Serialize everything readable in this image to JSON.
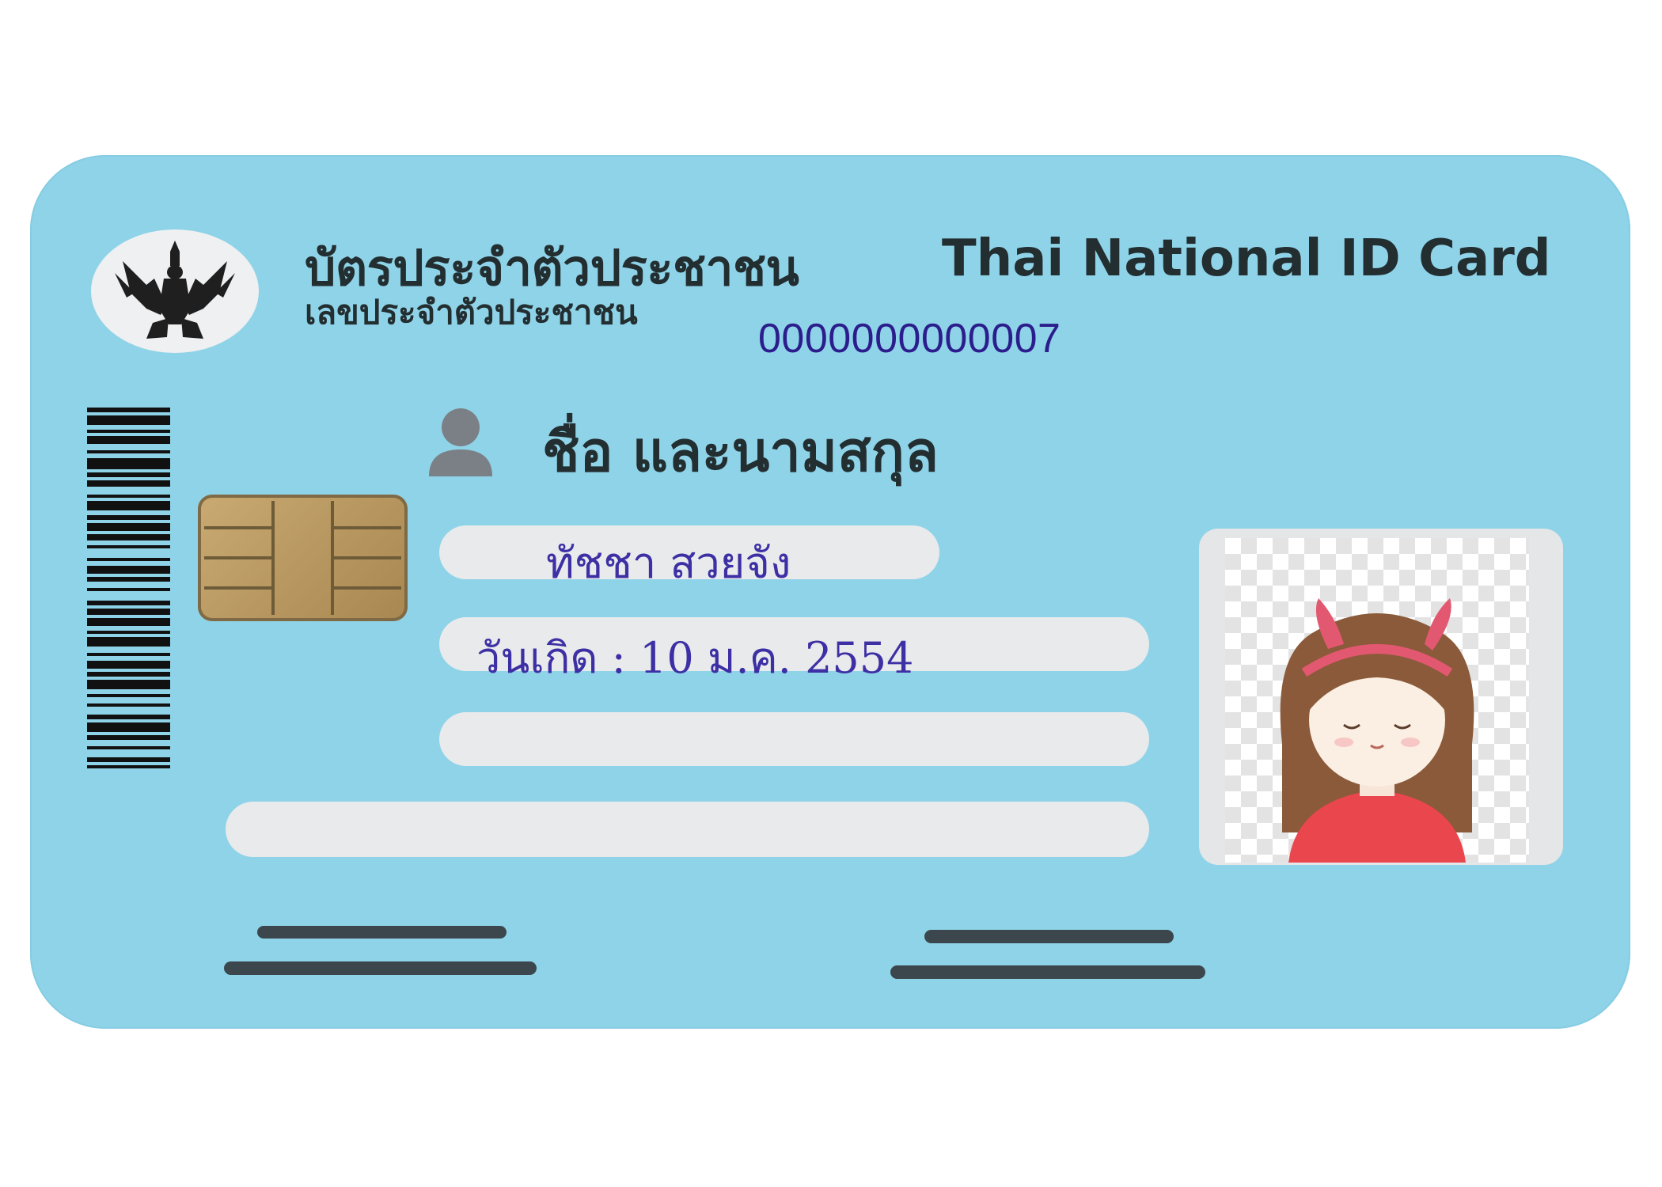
{
  "card": {
    "title_thai": "บัตรประจำตัวประชาชน",
    "title_english": "Thai National ID Card",
    "id_label": "เลขประจำตัวประชาชน",
    "id_number": "0000000000007",
    "name_label": "ชื่อ และนามสกุล",
    "holder_name": "ทัชชา  สวยจัง",
    "birth_date": "วันเกิด : 10 ม.ค. 2554"
  },
  "icons": {
    "emblem": "garuda-emblem-icon",
    "person": "person-icon",
    "chip": "smart-chip-icon"
  },
  "colors": {
    "card": "#8fd3e8",
    "heading_text": "#232e31",
    "filled_text": "#3d2fa4",
    "id_number_text": "#2b1d8c"
  }
}
